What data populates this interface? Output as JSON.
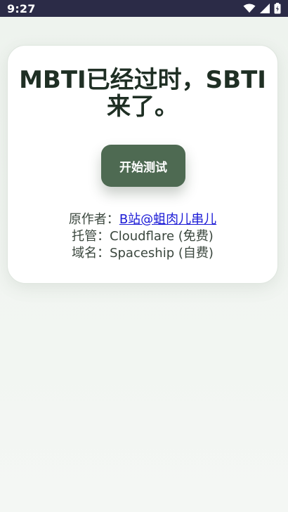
{
  "status_bar": {
    "time": "9:27",
    "icons": [
      "wifi-icon",
      "signal-icon",
      "battery-icon"
    ]
  },
  "card": {
    "title": "MBTI已经过时，SBTI来了。",
    "start_button_label": "开始测试",
    "credits": {
      "author_label": "原作者：",
      "author_link": "B站@蛆肉儿串儿",
      "hosting_label": "托管：",
      "hosting_value": "Cloudflare (免费)",
      "domain_label": "域名：",
      "domain_value": "Spaceship (自费)"
    }
  },
  "colors": {
    "status_bar": "#2b2b47",
    "button": "#4e6a52",
    "title": "#1f2f24",
    "link": "#1a19d6",
    "background": "#eef3ee"
  }
}
